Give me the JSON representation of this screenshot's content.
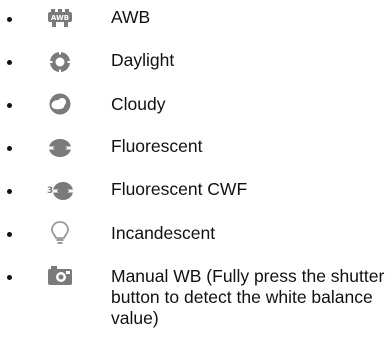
{
  "wb_modes": [
    {
      "label": "AWB",
      "icon": "awb-icon"
    },
    {
      "label": "Daylight",
      "icon": "daylight-icon"
    },
    {
      "label": "Cloudy",
      "icon": "cloudy-icon"
    },
    {
      "label": "Fluorescent",
      "icon": "fluorescent-icon"
    },
    {
      "label": "Fluorescent CWF",
      "icon": "fluorescent-cwf-icon"
    },
    {
      "label": "Incandescent",
      "icon": "incandescent-icon"
    },
    {
      "label": "Manual WB (Fully press the shutter button to detect the white balance value)",
      "icon": "manual-wb-icon"
    }
  ],
  "colors": {
    "text": "#111111",
    "icon": "#7a7a7a",
    "background": "#ffffff"
  }
}
